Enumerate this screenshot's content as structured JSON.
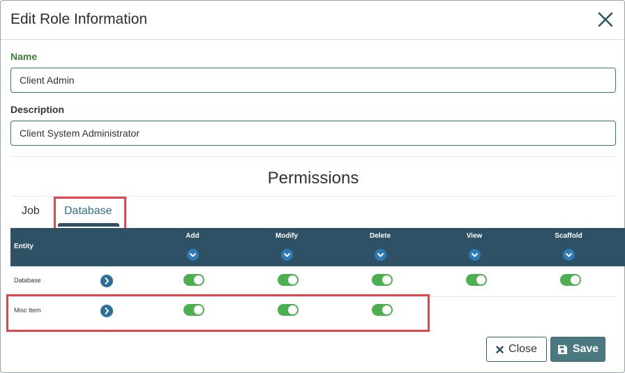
{
  "dialog": {
    "title": "Edit Role Information",
    "close_icon": "close-x-icon"
  },
  "form": {
    "name_label": "Name",
    "name_value": "Client Admin",
    "description_label": "Description",
    "description_value": "Client System Administrator"
  },
  "permissions": {
    "title": "Permissions",
    "tabs": [
      {
        "label": "Job",
        "active": false
      },
      {
        "label": "Database",
        "active": true
      }
    ],
    "columns": {
      "entity": "Entity",
      "add": "Add",
      "modify": "Modify",
      "delete": "Delete",
      "view": "View",
      "scaffold": "Scaffold"
    },
    "rows": [
      {
        "entity": "Database",
        "add": true,
        "modify": true,
        "delete": true,
        "view": true,
        "scaffold": true
      },
      {
        "entity": "Misc Item",
        "add": true,
        "modify": true,
        "delete": true,
        "view": null,
        "scaffold": null
      }
    ]
  },
  "footer": {
    "close_label": "Close",
    "save_label": "Save"
  },
  "colors": {
    "header_bg": "#2e5166",
    "toggle_on": "#4caf50",
    "highlight": "#e2474b",
    "save_bg": "#4a7a7f"
  }
}
